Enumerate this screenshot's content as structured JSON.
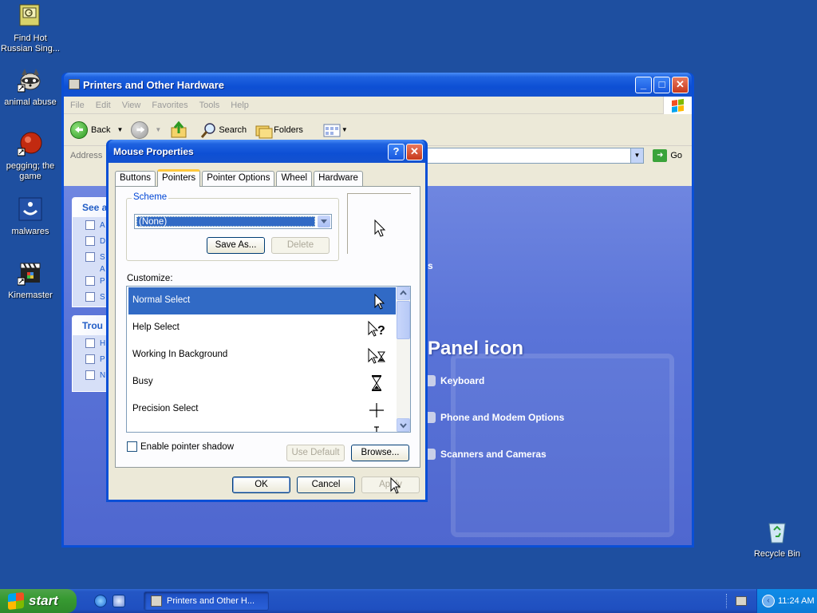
{
  "desktop": {
    "icons": [
      {
        "label_line1": "Find Hot",
        "label_line2": "Russian Sing..."
      },
      {
        "label_line1": "animal abuse",
        "label_line2": ""
      },
      {
        "label_line1": "pegging; the",
        "label_line2": "game"
      },
      {
        "label_line1": "malwares",
        "label_line2": ""
      },
      {
        "label_line1": "Kinemaster",
        "label_line2": ""
      }
    ],
    "recycle_bin": "Recycle Bin"
  },
  "explorer": {
    "title": "Printers and Other Hardware",
    "menu": [
      "File",
      "Edit",
      "View",
      "Favorites",
      "Tools",
      "Help"
    ],
    "toolbar": {
      "back": "Back",
      "search": "Search",
      "folders": "Folders"
    },
    "address_label": "Address",
    "go": "Go",
    "panels": [
      {
        "heading": "See a"
      },
      {
        "heading": "Trou"
      }
    ],
    "see_also_letters": [
      "A",
      "D",
      "S",
      "A",
      "P",
      "S"
    ],
    "troubleshoot_letters": [
      "H",
      "P",
      "N"
    ],
    "heading_fragment": "Panel icon",
    "fragment_s": "s",
    "links": [
      "Keyboard",
      "Phone and Modem Options",
      "Scanners and Cameras"
    ]
  },
  "dialog": {
    "title": "Mouse Properties",
    "tabs": [
      "Buttons",
      "Pointers",
      "Pointer Options",
      "Wheel",
      "Hardware"
    ],
    "scheme_legend": "Scheme",
    "scheme_value": "(None)",
    "save_as": "Save As...",
    "delete": "Delete",
    "customize_label": "Customize:",
    "cursors": [
      {
        "name": "Normal Select",
        "icon": "arrow-cursor-icon"
      },
      {
        "name": "Help Select",
        "icon": "help-cursor-icon"
      },
      {
        "name": "Working In Background",
        "icon": "working-cursor-icon"
      },
      {
        "name": "Busy",
        "icon": "hourglass-cursor-icon"
      },
      {
        "name": "Precision Select",
        "icon": "crosshair-cursor-icon"
      }
    ],
    "shadow_label": "Enable pointer shadow",
    "use_default": "Use Default",
    "browse": "Browse...",
    "ok": "OK",
    "cancel": "Cancel",
    "apply": "Apply"
  },
  "taskbar": {
    "start": "start",
    "task_button": "Printers and Other H...",
    "clock": "11:24 AM"
  },
  "colors": {
    "desktop": "#1e4fa0",
    "xp_title_blue": "#0a4fd6",
    "selection": "#316ac5",
    "start_green": "#379a32",
    "tab_highlight": "#ffc83c"
  }
}
